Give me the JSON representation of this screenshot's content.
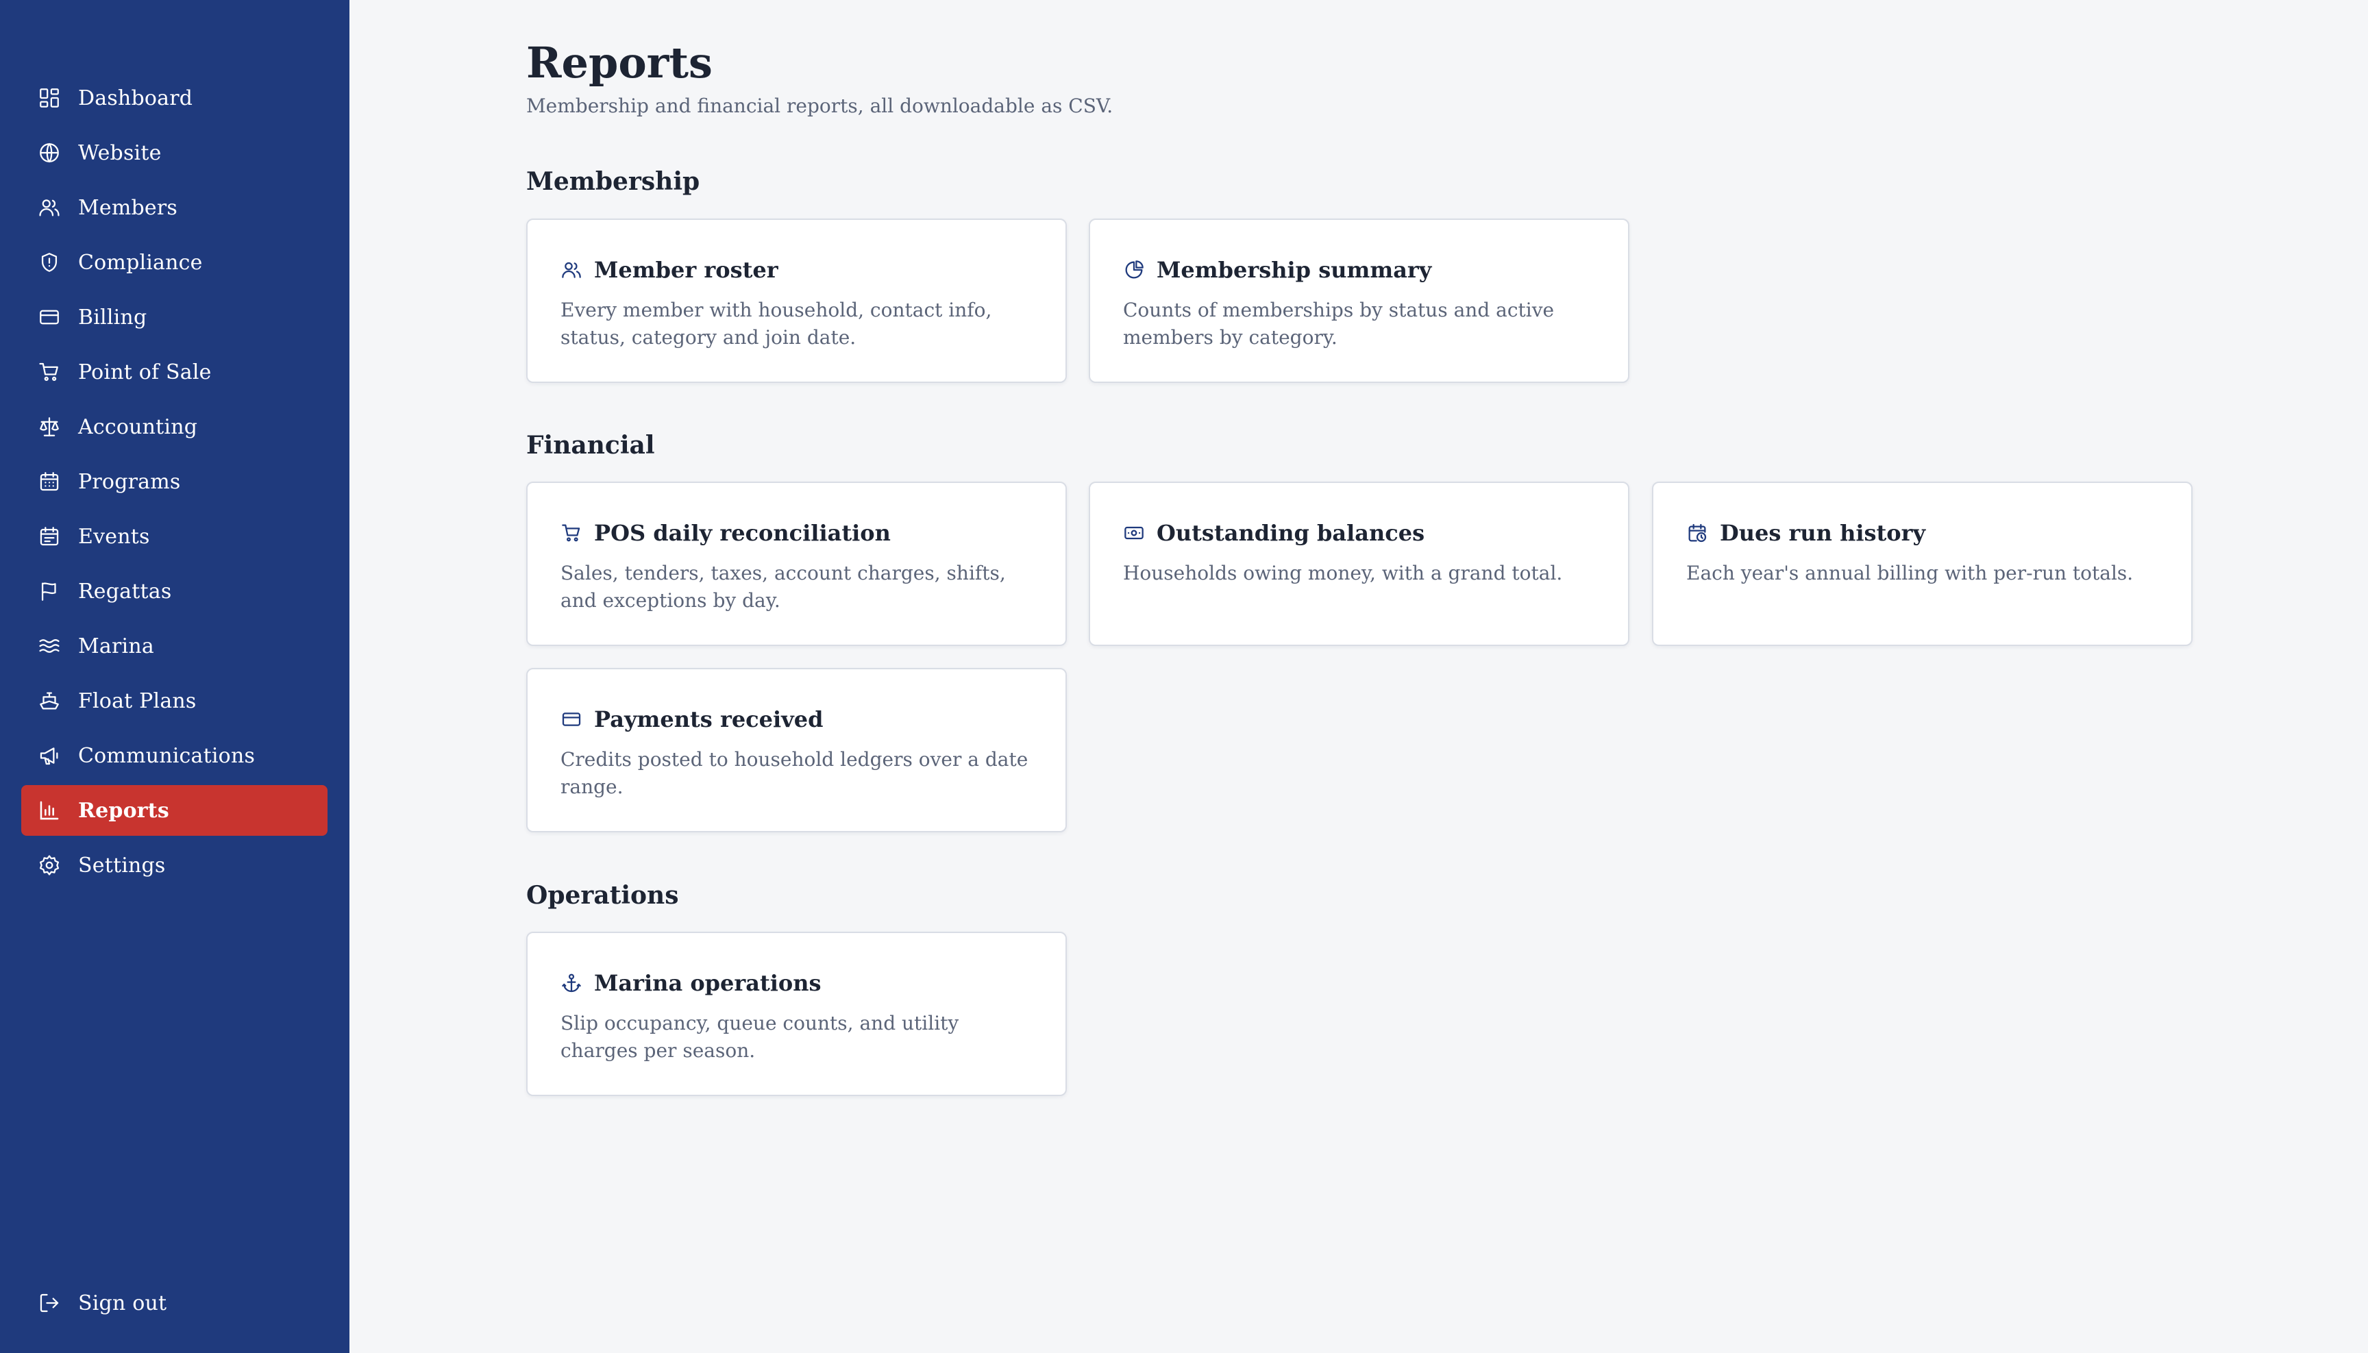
{
  "sidebar": {
    "items": [
      {
        "label": "Dashboard",
        "icon": "dashboard-icon",
        "active": false
      },
      {
        "label": "Website",
        "icon": "globe-icon",
        "active": false
      },
      {
        "label": "Members",
        "icon": "users-icon",
        "active": false
      },
      {
        "label": "Compliance",
        "icon": "shield-icon",
        "active": false
      },
      {
        "label": "Billing",
        "icon": "credit-card-icon",
        "active": false
      },
      {
        "label": "Point of Sale",
        "icon": "cart-icon",
        "active": false
      },
      {
        "label": "Accounting",
        "icon": "scale-icon",
        "active": false
      },
      {
        "label": "Programs",
        "icon": "calendar-grid-icon",
        "active": false
      },
      {
        "label": "Events",
        "icon": "calendar-icon",
        "active": false
      },
      {
        "label": "Regattas",
        "icon": "flag-icon",
        "active": false
      },
      {
        "label": "Marina",
        "icon": "waves-icon",
        "active": false
      },
      {
        "label": "Float Plans",
        "icon": "boat-icon",
        "active": false
      },
      {
        "label": "Communications",
        "icon": "megaphone-icon",
        "active": false
      },
      {
        "label": "Reports",
        "icon": "bar-chart-icon",
        "active": true
      },
      {
        "label": "Settings",
        "icon": "gear-icon",
        "active": false
      }
    ],
    "signout": {
      "label": "Sign out",
      "icon": "sign-out-icon"
    }
  },
  "page": {
    "title": "Reports",
    "subtitle": "Membership and financial reports, all downloadable as CSV."
  },
  "sections": [
    {
      "title": "Membership",
      "cards": [
        {
          "title": "Member roster",
          "icon": "users-icon",
          "description": "Every member with household, contact info, status, category and join date."
        },
        {
          "title": "Membership summary",
          "icon": "pie-chart-icon",
          "description": "Counts of memberships by status and active members by category."
        }
      ]
    },
    {
      "title": "Financial",
      "cards": [
        {
          "title": "POS daily reconciliation",
          "icon": "cart-icon",
          "description": "Sales, tenders, taxes, account charges, shifts, and exceptions by day."
        },
        {
          "title": "Outstanding balances",
          "icon": "banknote-icon",
          "description": "Households owing money, with a grand total."
        },
        {
          "title": "Dues run history",
          "icon": "calendar-clock-icon",
          "description": "Each year's annual billing with per-run totals."
        },
        {
          "title": "Payments received",
          "icon": "credit-card-icon",
          "description": "Credits posted to household ledgers over a date range."
        }
      ]
    },
    {
      "title": "Operations",
      "cards": [
        {
          "title": "Marina operations",
          "icon": "anchor-icon",
          "description": "Slip occupancy, queue counts, and utility charges per season."
        }
      ]
    }
  ],
  "colors": {
    "sidebar_bg": "#1f3a7d",
    "active_item": "#c8342f",
    "page_bg": "#f5f6f8",
    "icon_color": "#1f3a7d"
  }
}
